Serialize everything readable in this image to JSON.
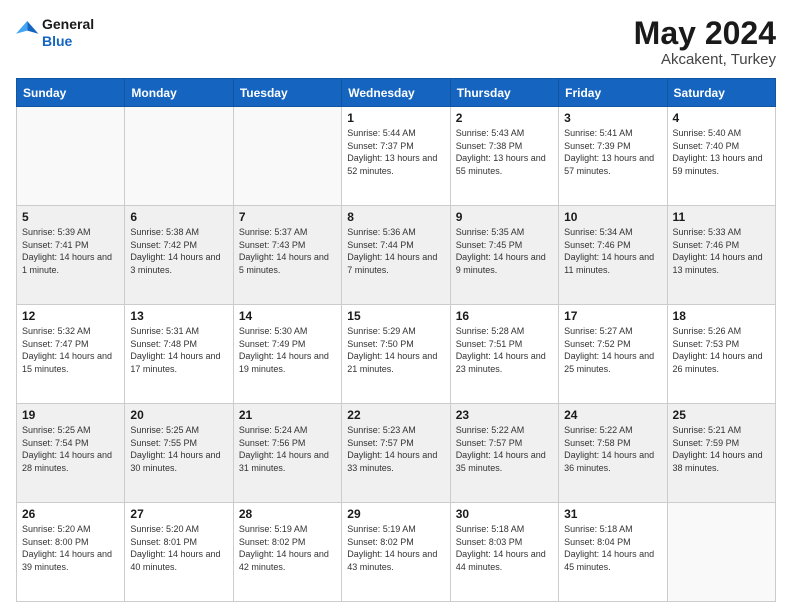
{
  "header": {
    "logo_line1": "General",
    "logo_line2": "Blue",
    "month_year": "May 2024",
    "location": "Akcakent, Turkey"
  },
  "days_of_week": [
    "Sunday",
    "Monday",
    "Tuesday",
    "Wednesday",
    "Thursday",
    "Friday",
    "Saturday"
  ],
  "weeks": [
    [
      {
        "day": "",
        "empty": true
      },
      {
        "day": "",
        "empty": true
      },
      {
        "day": "",
        "empty": true
      },
      {
        "day": "1",
        "sunrise": "5:44 AM",
        "sunset": "7:37 PM",
        "daylight": "13 hours and 52 minutes."
      },
      {
        "day": "2",
        "sunrise": "5:43 AM",
        "sunset": "7:38 PM",
        "daylight": "13 hours and 55 minutes."
      },
      {
        "day": "3",
        "sunrise": "5:41 AM",
        "sunset": "7:39 PM",
        "daylight": "13 hours and 57 minutes."
      },
      {
        "day": "4",
        "sunrise": "5:40 AM",
        "sunset": "7:40 PM",
        "daylight": "13 hours and 59 minutes."
      }
    ],
    [
      {
        "day": "5",
        "sunrise": "5:39 AM",
        "sunset": "7:41 PM",
        "daylight": "14 hours and 1 minute."
      },
      {
        "day": "6",
        "sunrise": "5:38 AM",
        "sunset": "7:42 PM",
        "daylight": "14 hours and 3 minutes."
      },
      {
        "day": "7",
        "sunrise": "5:37 AM",
        "sunset": "7:43 PM",
        "daylight": "14 hours and 5 minutes."
      },
      {
        "day": "8",
        "sunrise": "5:36 AM",
        "sunset": "7:44 PM",
        "daylight": "14 hours and 7 minutes."
      },
      {
        "day": "9",
        "sunrise": "5:35 AM",
        "sunset": "7:45 PM",
        "daylight": "14 hours and 9 minutes."
      },
      {
        "day": "10",
        "sunrise": "5:34 AM",
        "sunset": "7:46 PM",
        "daylight": "14 hours and 11 minutes."
      },
      {
        "day": "11",
        "sunrise": "5:33 AM",
        "sunset": "7:46 PM",
        "daylight": "14 hours and 13 minutes."
      }
    ],
    [
      {
        "day": "12",
        "sunrise": "5:32 AM",
        "sunset": "7:47 PM",
        "daylight": "14 hours and 15 minutes."
      },
      {
        "day": "13",
        "sunrise": "5:31 AM",
        "sunset": "7:48 PM",
        "daylight": "14 hours and 17 minutes."
      },
      {
        "day": "14",
        "sunrise": "5:30 AM",
        "sunset": "7:49 PM",
        "daylight": "14 hours and 19 minutes."
      },
      {
        "day": "15",
        "sunrise": "5:29 AM",
        "sunset": "7:50 PM",
        "daylight": "14 hours and 21 minutes."
      },
      {
        "day": "16",
        "sunrise": "5:28 AM",
        "sunset": "7:51 PM",
        "daylight": "14 hours and 23 minutes."
      },
      {
        "day": "17",
        "sunrise": "5:27 AM",
        "sunset": "7:52 PM",
        "daylight": "14 hours and 25 minutes."
      },
      {
        "day": "18",
        "sunrise": "5:26 AM",
        "sunset": "7:53 PM",
        "daylight": "14 hours and 26 minutes."
      }
    ],
    [
      {
        "day": "19",
        "sunrise": "5:25 AM",
        "sunset": "7:54 PM",
        "daylight": "14 hours and 28 minutes."
      },
      {
        "day": "20",
        "sunrise": "5:25 AM",
        "sunset": "7:55 PM",
        "daylight": "14 hours and 30 minutes."
      },
      {
        "day": "21",
        "sunrise": "5:24 AM",
        "sunset": "7:56 PM",
        "daylight": "14 hours and 31 minutes."
      },
      {
        "day": "22",
        "sunrise": "5:23 AM",
        "sunset": "7:57 PM",
        "daylight": "14 hours and 33 minutes."
      },
      {
        "day": "23",
        "sunrise": "5:22 AM",
        "sunset": "7:57 PM",
        "daylight": "14 hours and 35 minutes."
      },
      {
        "day": "24",
        "sunrise": "5:22 AM",
        "sunset": "7:58 PM",
        "daylight": "14 hours and 36 minutes."
      },
      {
        "day": "25",
        "sunrise": "5:21 AM",
        "sunset": "7:59 PM",
        "daylight": "14 hours and 38 minutes."
      }
    ],
    [
      {
        "day": "26",
        "sunrise": "5:20 AM",
        "sunset": "8:00 PM",
        "daylight": "14 hours and 39 minutes."
      },
      {
        "day": "27",
        "sunrise": "5:20 AM",
        "sunset": "8:01 PM",
        "daylight": "14 hours and 40 minutes."
      },
      {
        "day": "28",
        "sunrise": "5:19 AM",
        "sunset": "8:02 PM",
        "daylight": "14 hours and 42 minutes."
      },
      {
        "day": "29",
        "sunrise": "5:19 AM",
        "sunset": "8:02 PM",
        "daylight": "14 hours and 43 minutes."
      },
      {
        "day": "30",
        "sunrise": "5:18 AM",
        "sunset": "8:03 PM",
        "daylight": "14 hours and 44 minutes."
      },
      {
        "day": "31",
        "sunrise": "5:18 AM",
        "sunset": "8:04 PM",
        "daylight": "14 hours and 45 minutes."
      },
      {
        "day": "",
        "empty": true
      }
    ]
  ]
}
